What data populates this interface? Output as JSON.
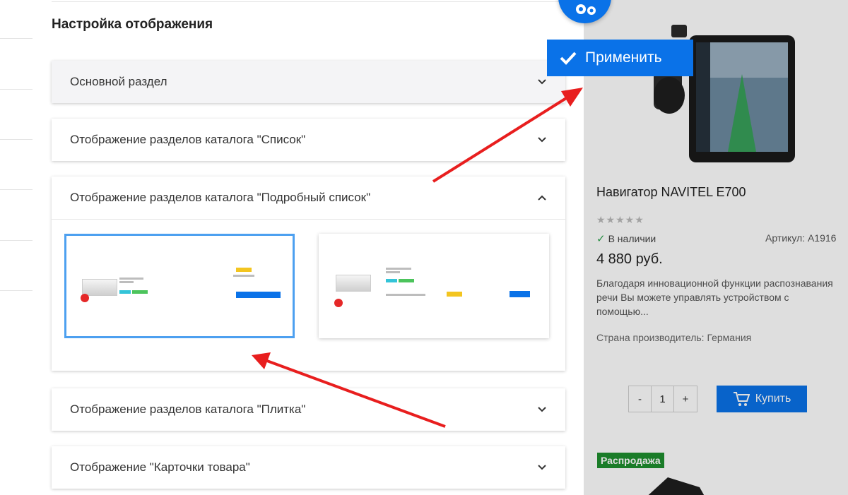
{
  "settings_panel": {
    "title": "Настройка отображения",
    "sections": [
      {
        "label": "Основной раздел",
        "expanded": false
      },
      {
        "label": "Отображение разделов каталога \"Список\"",
        "expanded": false
      },
      {
        "label": "Отображение разделов каталога \"Подробный список\"",
        "expanded": true
      },
      {
        "label": "Отображение разделов каталога \"Плитка\"",
        "expanded": false
      },
      {
        "label": "Отображение \"Карточки товара\"",
        "expanded": false
      }
    ],
    "apply_label": "Применить"
  },
  "product": {
    "name": "Навигатор NAVITEL E700",
    "stars": "★★★★★",
    "stock": "В наличии",
    "sku": "Артикул: A1916",
    "price": "4 880 руб.",
    "description": "Благодаря инновационной функции распознавания речи Вы можете управлять устройством с помощью...",
    "country": "Страна производитель: Германия",
    "qty_minus": "-",
    "qty_value": "1",
    "qty_plus": "+",
    "buy_label": "Купить",
    "sale_badge": "Распродажа"
  },
  "colors": {
    "accent": "#0a72e8",
    "selected_border": "#4da0f0",
    "annotation_arrow": "#e81e1e",
    "in_stock": "#2ba24c",
    "sale": "#1e8f2e"
  }
}
